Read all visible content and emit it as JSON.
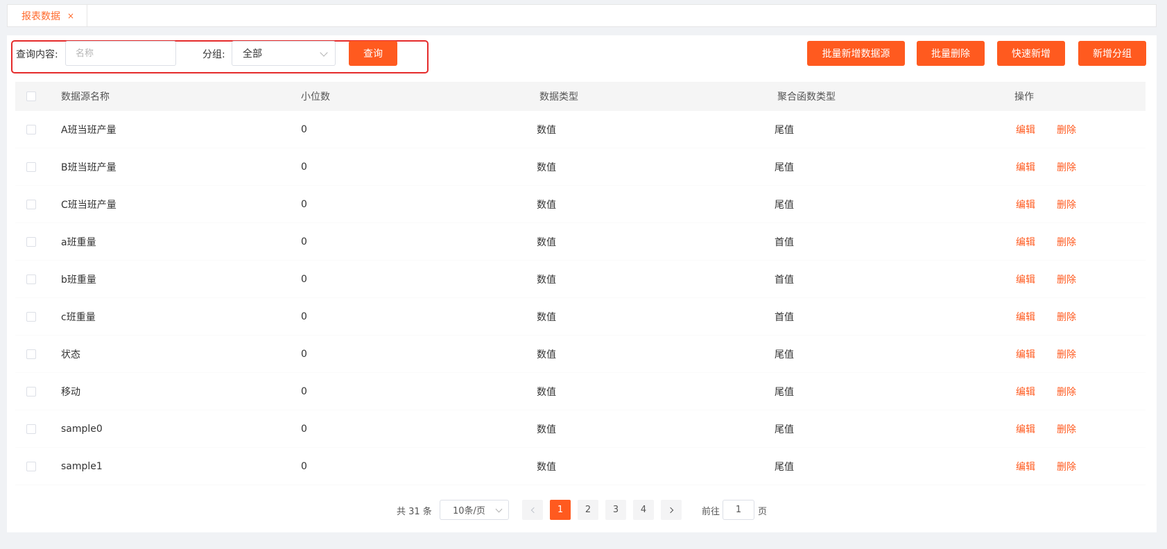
{
  "tabs": [
    {
      "label": "报表数据",
      "close": "×"
    }
  ],
  "query": {
    "content_label": "查询内容:",
    "content_placeholder": "名称",
    "group_label": "分组:",
    "group_value": "全部",
    "search_label": "查询"
  },
  "actions": {
    "batch_add_label": "批量新增数据源",
    "batch_delete_label": "批量删除",
    "quick_add_label": "快速新增",
    "add_group_label": "新增分组"
  },
  "table": {
    "columns": [
      "数据源名称",
      "小位数",
      "数据类型",
      "聚合函数类型",
      "操作"
    ],
    "ops": {
      "edit": "编辑",
      "delete": "删除"
    },
    "rows": [
      {
        "name": "A班当班产量",
        "decimals": "0",
        "type": "数值",
        "agg": "尾值"
      },
      {
        "name": "B班当班产量",
        "decimals": "0",
        "type": "数值",
        "agg": "尾值"
      },
      {
        "name": "C班当班产量",
        "decimals": "0",
        "type": "数值",
        "agg": "尾值"
      },
      {
        "name": "a班重量",
        "decimals": "0",
        "type": "数值",
        "agg": "首值"
      },
      {
        "name": "b班重量",
        "decimals": "0",
        "type": "数值",
        "agg": "首值"
      },
      {
        "name": "c班重量",
        "decimals": "0",
        "type": "数值",
        "agg": "首值"
      },
      {
        "name": "状态",
        "decimals": "0",
        "type": "数值",
        "agg": "尾值"
      },
      {
        "name": "移动",
        "decimals": "0",
        "type": "数值",
        "agg": "尾值"
      },
      {
        "name": "sample0",
        "decimals": "0",
        "type": "数值",
        "agg": "尾值"
      },
      {
        "name": "sample1",
        "decimals": "0",
        "type": "数值",
        "agg": "尾值"
      }
    ]
  },
  "pagination": {
    "total_text": "共 31 条",
    "page_size": "10条/页",
    "pages": [
      "1",
      "2",
      "3",
      "4"
    ],
    "current_page": "1",
    "goto_label": "前往",
    "goto_value": "1",
    "page_unit": "页"
  },
  "colors": {
    "accent": "#ff5a1f",
    "highlight_border": "#e52b2b"
  }
}
